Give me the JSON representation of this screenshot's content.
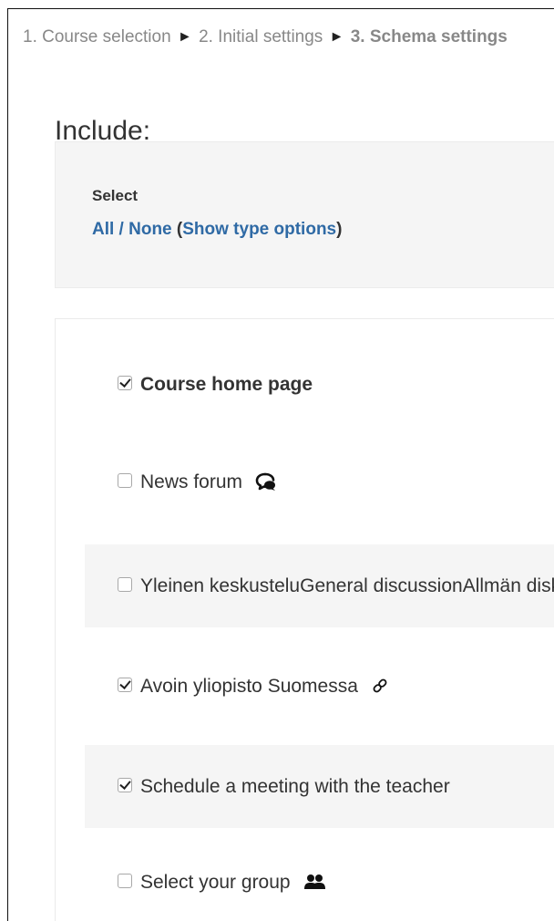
{
  "breadcrumb": {
    "step1": "1. Course selection",
    "sep": "►",
    "step2": "2. Initial settings",
    "step3": "3. Schema settings"
  },
  "page_title": "Include:",
  "select_panel": {
    "heading": "Select",
    "all": "All",
    "slash": " / ",
    "none": "None",
    "open_paren": " (",
    "show_type_options": "Show type options",
    "close_paren": ")"
  },
  "items": [
    {
      "label": "Course home page",
      "checked": true,
      "bold": true,
      "icon": null
    },
    {
      "label": "News forum",
      "checked": false,
      "bold": false,
      "icon": "forum-icon"
    },
    {
      "label": "Yleinen keskusteluGeneral discussionAllmän diskussion",
      "checked": false,
      "bold": false,
      "icon": null
    },
    {
      "label": "Avoin yliopisto Suomessa",
      "checked": true,
      "bold": false,
      "icon": "link-icon"
    },
    {
      "label": "Schedule a meeting with the teacher",
      "checked": true,
      "bold": false,
      "icon": null
    },
    {
      "label": "Select your group",
      "checked": false,
      "bold": false,
      "icon": "group-icon"
    }
  ],
  "colors": {
    "link": "#2f6aa5",
    "panel_bg": "#f5f5f5",
    "text": "#333333",
    "breadcrumb": "#888888"
  }
}
